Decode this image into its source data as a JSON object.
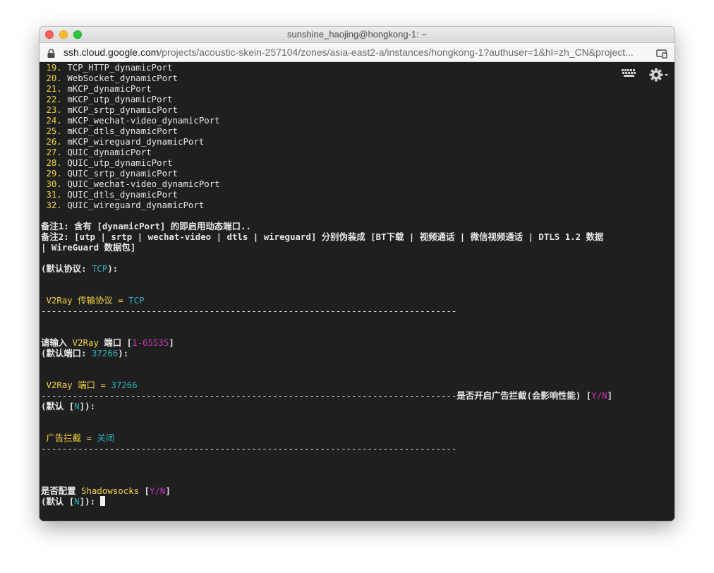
{
  "window": {
    "title": "sunshine_haojing@hongkong-1: ~"
  },
  "address": {
    "host": "ssh.cloud.google.com",
    "path": "/projects/acoustic-skein-257104/zones/asia-east2-a/instances/hongkong-1?authuser=1&hl=zh_CN&project..."
  },
  "icons": {
    "lock": "lock-icon",
    "cast": "cast-icon",
    "keyboard": "keyboard-icon",
    "gear": "gear-icon"
  },
  "colors": {
    "terminal_bg": "#1f1f1f",
    "yellow": "#f0d43a",
    "cyan": "#2ab0b8",
    "magenta": "#c736b5"
  },
  "terminal": {
    "list": [
      {
        "num": "19.",
        "text": "TCP_HTTP_dynamicPort"
      },
      {
        "num": "20.",
        "text": "WebSocket_dynamicPort"
      },
      {
        "num": "21.",
        "text": "mKCP_dynamicPort"
      },
      {
        "num": "22.",
        "text": "mKCP_utp_dynamicPort"
      },
      {
        "num": "23.",
        "text": "mKCP_srtp_dynamicPort"
      },
      {
        "num": "24.",
        "text": "mKCP_wechat-video_dynamicPort"
      },
      {
        "num": "25.",
        "text": "mKCP_dtls_dynamicPort"
      },
      {
        "num": "26.",
        "text": "mKCP_wireguard_dynamicPort"
      },
      {
        "num": "27.",
        "text": "QUIC_dynamicPort"
      },
      {
        "num": "28.",
        "text": "QUIC_utp_dynamicPort"
      },
      {
        "num": "29.",
        "text": "QUIC_srtp_dynamicPort"
      },
      {
        "num": "30.",
        "text": "QUIC_wechat-video_dynamicPort"
      },
      {
        "num": "31.",
        "text": "QUIC_dtls_dynamicPort"
      },
      {
        "num": "32.",
        "text": "QUIC_wireguard_dynamicPort"
      }
    ],
    "note1": "备注1: 含有 [dynamicPort] 的即启用动态端口..",
    "note2a": "备注2: [utp | srtp | wechat-video | dtls | wireguard] 分别伪装成 [BT下载 | 视频通话 | 微信视频通话 | DTLS 1.2 数据",
    "note2b": "| WireGuard 数据包]",
    "default_proto_label": "(默认协议: ",
    "default_proto_value": "TCP",
    "default_proto_end": "):",
    "result1_label": " V2Ray 传输协议 = ",
    "result1_value": "TCP",
    "divider": "-------------------------------------------------------------------------------",
    "port_prompt_a": "请输入 ",
    "port_prompt_b": "V2Ray",
    "port_prompt_c": " 端口 [",
    "port_prompt_range": "1-65535",
    "port_prompt_end": "]",
    "default_port_label": "(默认端口: ",
    "default_port_value": "37266",
    "default_port_end": "):",
    "result2_label": " V2Ray 端口 = ",
    "result2_value": "37266",
    "adblock_prompt": "是否开启广告拦截(会影响性能) [",
    "adblock_yn": "Y/N",
    "adblock_end": "]",
    "adblock_default_a": "(默认 [",
    "adblock_default_n": "N",
    "adblock_default_b": "]):",
    "result3_label": " 广告拦截 = ",
    "result3_value": "关闭",
    "ss_prompt_a": "是否配置 ",
    "ss_prompt_b": "Shadowsocks",
    "ss_prompt_c": " [",
    "ss_yn": "Y/N",
    "ss_end": "]",
    "ss_default_a": "(默认 [",
    "ss_default_n": "N",
    "ss_default_b": "]): "
  }
}
